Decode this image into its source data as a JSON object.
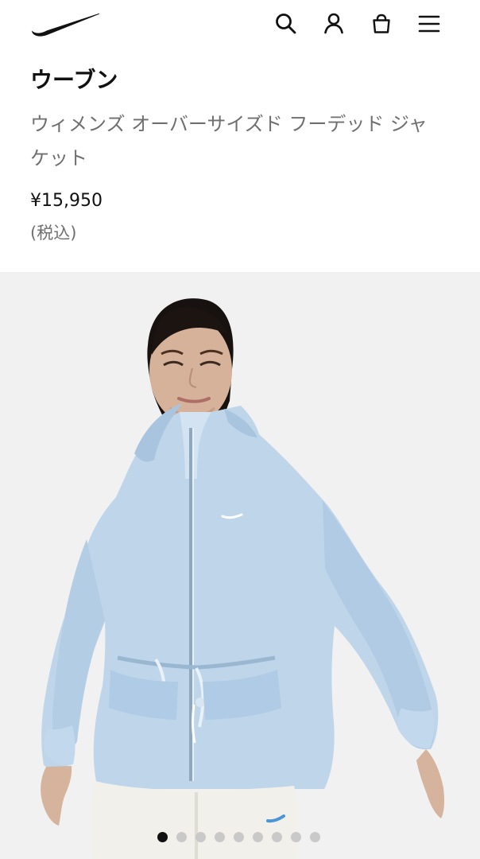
{
  "header": {
    "icons": [
      "nike-logo-icon",
      "search-icon",
      "account-icon",
      "bag-icon",
      "menu-icon"
    ]
  },
  "product": {
    "title": "ウーブン",
    "subtitle": "ウィメンズ オーバーサイズド フーデッド ジャケット",
    "price": "¥15,950",
    "tax_label": "(税込)"
  },
  "gallery": {
    "image_name": "blue hooded jacket model image",
    "dot_count": 9,
    "active_index": 0
  }
}
